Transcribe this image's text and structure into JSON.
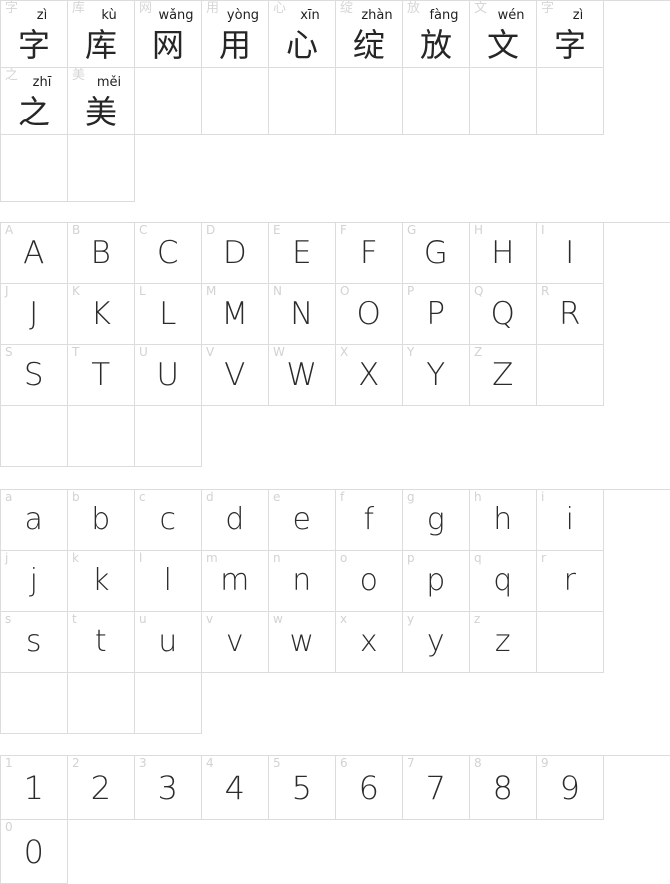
{
  "page": {
    "title": "Font Specimen Preview",
    "background_color": "#ffffff",
    "grid_border_color": "#dcdcdc",
    "label_color": "#d2d2d2",
    "glyph_color": "#2b2b2b",
    "columns": 10
  },
  "sections": [
    {
      "name": "chinese-characters",
      "rows": 2,
      "cells": [
        {
          "ref": "字",
          "pinyin": "zì",
          "glyph": "字"
        },
        {
          "ref": "库",
          "pinyin": "kù",
          "glyph": "库"
        },
        {
          "ref": "网",
          "pinyin": "wǎng",
          "glyph": "网"
        },
        {
          "ref": "用",
          "pinyin": "yòng",
          "glyph": "用"
        },
        {
          "ref": "心",
          "pinyin": "xīn",
          "glyph": "心"
        },
        {
          "ref": "绽",
          "pinyin": "zhàn",
          "glyph": "绽"
        },
        {
          "ref": "放",
          "pinyin": "fàng",
          "glyph": "放"
        },
        {
          "ref": "文",
          "pinyin": "wén",
          "glyph": "文"
        },
        {
          "ref": "字",
          "pinyin": "zì",
          "glyph": "字"
        },
        {
          "ref": "之",
          "pinyin": "zhī",
          "glyph": "之"
        },
        {
          "ref": "美",
          "pinyin": "měi",
          "glyph": "美"
        },
        {
          "empty": true
        },
        {
          "empty": true
        },
        {
          "empty": true
        },
        {
          "empty": true
        },
        {
          "empty": true
        },
        {
          "empty": true
        },
        {
          "empty": true
        },
        {
          "empty": true
        },
        {
          "empty": true
        }
      ]
    },
    {
      "name": "uppercase-letters",
      "rows": 3,
      "cells": [
        {
          "ref": "A",
          "glyph": "A"
        },
        {
          "ref": "B",
          "glyph": "B"
        },
        {
          "ref": "C",
          "glyph": "C"
        },
        {
          "ref": "D",
          "glyph": "D"
        },
        {
          "ref": "E",
          "glyph": "E"
        },
        {
          "ref": "F",
          "glyph": "F"
        },
        {
          "ref": "G",
          "glyph": "G"
        },
        {
          "ref": "H",
          "glyph": "H"
        },
        {
          "ref": "I",
          "glyph": "I"
        },
        {
          "ref": "J",
          "glyph": "J"
        },
        {
          "ref": "K",
          "glyph": "K"
        },
        {
          "ref": "L",
          "glyph": "L"
        },
        {
          "ref": "M",
          "glyph": "M"
        },
        {
          "ref": "N",
          "glyph": "N"
        },
        {
          "ref": "O",
          "glyph": "O"
        },
        {
          "ref": "P",
          "glyph": "P"
        },
        {
          "ref": "Q",
          "glyph": "Q"
        },
        {
          "ref": "R",
          "glyph": "R"
        },
        {
          "ref": "S",
          "glyph": "S"
        },
        {
          "ref": "T",
          "glyph": "T"
        },
        {
          "ref": "U",
          "glyph": "U"
        },
        {
          "ref": "V",
          "glyph": "V"
        },
        {
          "ref": "W",
          "glyph": "W"
        },
        {
          "ref": "X",
          "glyph": "X"
        },
        {
          "ref": "Y",
          "glyph": "Y"
        },
        {
          "ref": "Z",
          "glyph": "Z"
        },
        {
          "empty": true
        },
        {
          "empty": true
        },
        {
          "empty": true
        },
        {
          "empty": true
        }
      ]
    },
    {
      "name": "lowercase-letters",
      "rows": 3,
      "cells": [
        {
          "ref": "a",
          "glyph": "a"
        },
        {
          "ref": "b",
          "glyph": "b"
        },
        {
          "ref": "c",
          "glyph": "c"
        },
        {
          "ref": "d",
          "glyph": "d"
        },
        {
          "ref": "e",
          "glyph": "e"
        },
        {
          "ref": "f",
          "glyph": "f"
        },
        {
          "ref": "g",
          "glyph": "g"
        },
        {
          "ref": "h",
          "glyph": "h"
        },
        {
          "ref": "i",
          "glyph": "i"
        },
        {
          "ref": "j",
          "glyph": "j"
        },
        {
          "ref": "k",
          "glyph": "k"
        },
        {
          "ref": "l",
          "glyph": "l"
        },
        {
          "ref": "m",
          "glyph": "m"
        },
        {
          "ref": "n",
          "glyph": "n"
        },
        {
          "ref": "o",
          "glyph": "o"
        },
        {
          "ref": "p",
          "glyph": "p"
        },
        {
          "ref": "q",
          "glyph": "q"
        },
        {
          "ref": "r",
          "glyph": "r"
        },
        {
          "ref": "s",
          "glyph": "s"
        },
        {
          "ref": "t",
          "glyph": "t"
        },
        {
          "ref": "u",
          "glyph": "u"
        },
        {
          "ref": "v",
          "glyph": "v"
        },
        {
          "ref": "w",
          "glyph": "w"
        },
        {
          "ref": "x",
          "glyph": "x"
        },
        {
          "ref": "y",
          "glyph": "y"
        },
        {
          "ref": "z",
          "glyph": "z"
        },
        {
          "empty": true
        },
        {
          "empty": true
        },
        {
          "empty": true
        },
        {
          "empty": true
        }
      ]
    },
    {
      "name": "numerals",
      "rows": 1,
      "cells": [
        {
          "ref": "1",
          "glyph": "1"
        },
        {
          "ref": "2",
          "glyph": "2"
        },
        {
          "ref": "3",
          "glyph": "3"
        },
        {
          "ref": "4",
          "glyph": "4"
        },
        {
          "ref": "5",
          "glyph": "5"
        },
        {
          "ref": "6",
          "glyph": "6"
        },
        {
          "ref": "7",
          "glyph": "7"
        },
        {
          "ref": "8",
          "glyph": "8"
        },
        {
          "ref": "9",
          "glyph": "9"
        },
        {
          "ref": "0",
          "glyph": "0"
        }
      ]
    }
  ]
}
